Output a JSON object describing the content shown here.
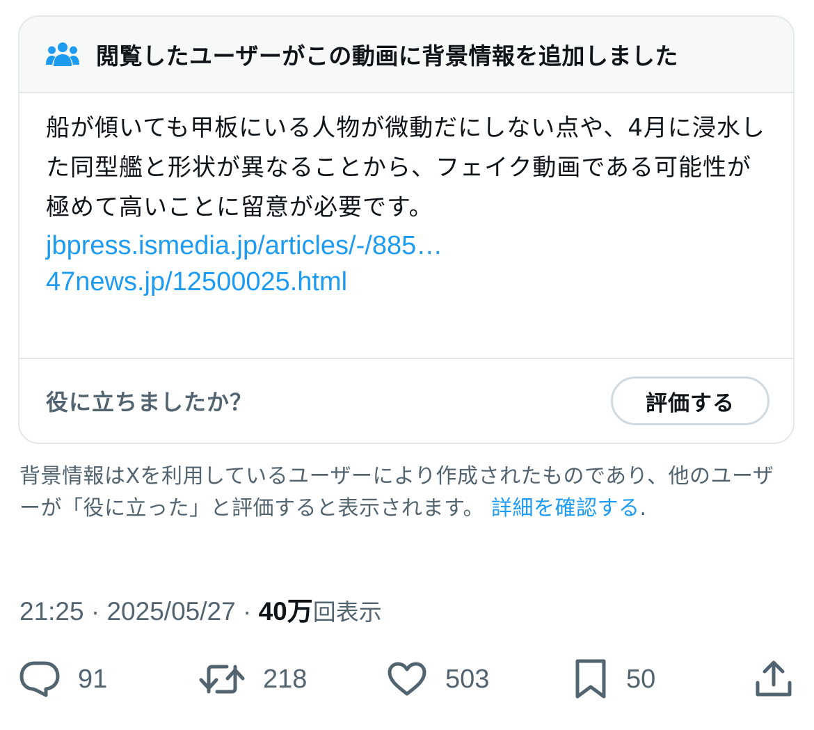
{
  "note": {
    "title": "閲覧したユーザーがこの動画に背景情報を追加しました",
    "body": "船が傾いても甲板にいる人物が微動だにしない点や、4月に浸水した同型艦と形状が異なることから、フェイク動画である可能性が極めて高いことに留意が必要です。",
    "links": [
      "jbpress.ismedia.jp/articles/-/885…",
      "47news.jp/12500025.html"
    ],
    "helpful_question": "役に立ちましたか？",
    "rate_button": "評価する"
  },
  "disclaimer": {
    "text": "背景情報はXを利用しているユーザーにより作成されたものであり、他のユーザーが「役に立った」と評価すると表示されます。 ",
    "learn_more": "詳細を確認する",
    "period": "."
  },
  "meta": {
    "time": "21:25",
    "separator": " · ",
    "date": "2025/05/27",
    "views_count": "40万",
    "views_label": "回表示"
  },
  "actions": {
    "replies": "91",
    "reposts": "218",
    "likes": "503",
    "bookmarks": "50"
  },
  "icons": {
    "header": "community-people-icon",
    "reply": "reply-bubble-icon",
    "repost": "repost-arrows-icon",
    "like": "heart-icon",
    "bookmark": "bookmark-icon",
    "share": "share-upload-icon"
  },
  "colors": {
    "accent": "#1d9bf0",
    "text": "#0f1419",
    "secondary": "#536471",
    "border": "#e3e7ea",
    "header_bg": "#f7f9f9"
  }
}
